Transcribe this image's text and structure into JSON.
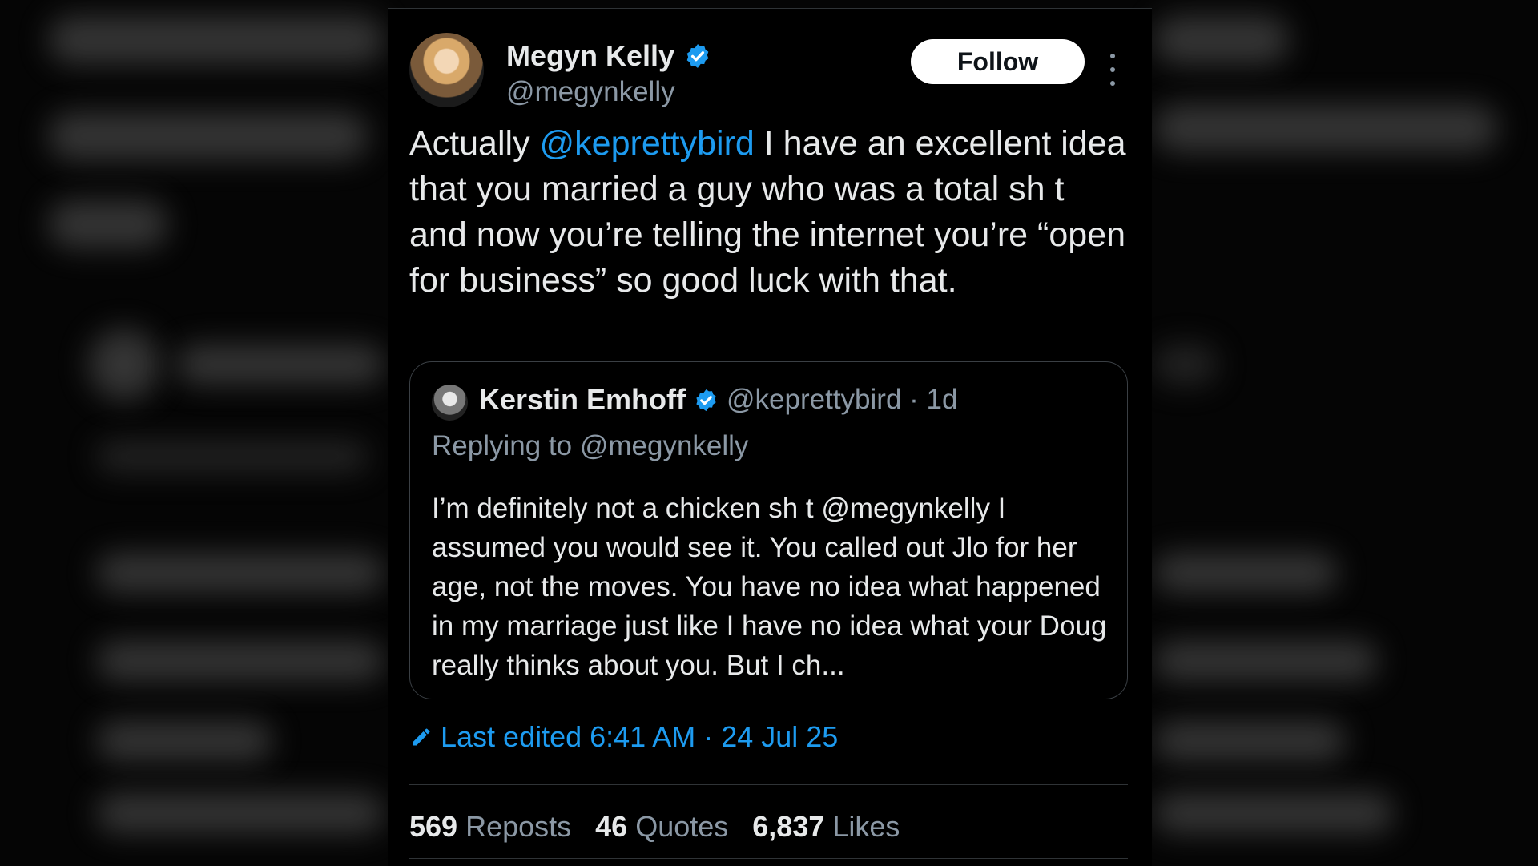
{
  "author": {
    "name": "Megyn Kelly",
    "handle": "@megynkelly",
    "verified_icon": "verified-badge-icon"
  },
  "follow_label": "Follow",
  "more_icon": "more-options-icon",
  "tweet": {
    "prefix": "Actually ",
    "mention": "@keprettybird",
    "rest": " I have an excellent idea that you married a guy who was a total sh t and now you’re telling the internet you’re “open for business” so good luck with that."
  },
  "quoted": {
    "name": "Kerstin Emhoff",
    "handle_time": "@keprettybird · 1d",
    "replying_to": "Replying to @megynkelly",
    "text": "I’m definitely not a chicken sh t @megynkelly I assumed you would see it. You called out Jlo for her age, not the moves. You have no idea what happened in my marriage just like I have no idea what your Doug really thinks about you. But I ch..."
  },
  "edited": {
    "icon": "pencil-icon",
    "label": "Last edited 6:41 AM · 24 Jul 25"
  },
  "stats": {
    "reposts_count": "569",
    "reposts_label": "Reposts",
    "quotes_count": "46",
    "quotes_label": "Quotes",
    "likes_count": "6,837",
    "likes_label": "Likes"
  },
  "colors": {
    "accent": "#1d9bf0",
    "background": "#000000",
    "muted": "#8b98a5"
  }
}
